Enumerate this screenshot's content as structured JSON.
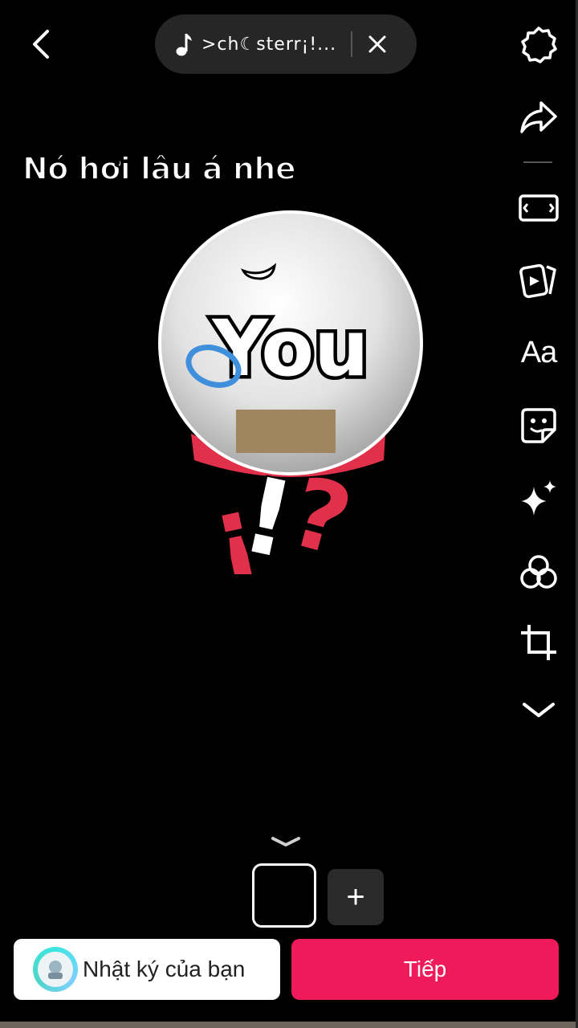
{
  "top": {
    "music_title": ">ch☾sterr¡!...",
    "back_icon": "chevron-left-icon",
    "close_icon": "close-icon"
  },
  "caption": "Nó hơi lâu á nhe",
  "sticker": {
    "text": "You",
    "punct_left": "¡",
    "punct_mid": "!",
    "punct_right": "?",
    "colors": {
      "face": "#e6e6e6",
      "collar": "#e0304a",
      "tape": "#a0865f",
      "ring": "#3f8fdc"
    }
  },
  "toolbar": {
    "items": [
      "settings-icon",
      "share-icon",
      "aspect-ratio-icon",
      "templates-icon",
      "text-icon",
      "sticker-icon",
      "effects-icon",
      "filters-icon",
      "crop-icon",
      "more-chevron-icon"
    ],
    "text_label": "Aa"
  },
  "bottom": {
    "add_label": "+",
    "diary_label": "Nhật ký của bạn",
    "next_label": "Tiếp",
    "accent": "#ef1a5a"
  }
}
